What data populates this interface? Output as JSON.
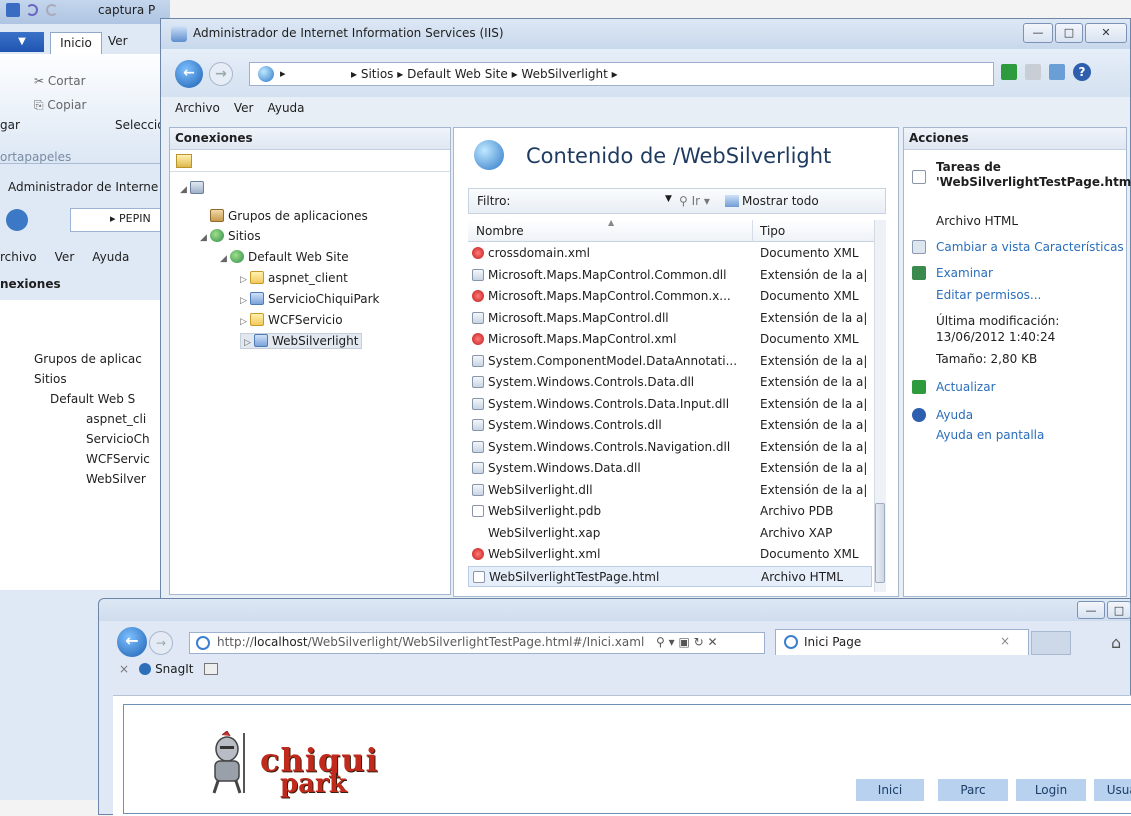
{
  "paint": {
    "title": "captura",
    "title_tail": "P",
    "tabs": [
      "Inicio",
      "Ver"
    ],
    "cortar": "Cortar",
    "copiar": "Copiar",
    "pegar": "gar",
    "seleccion": "Seleccio",
    "portapapeles": "ortapapeles",
    "image_title": "Administrador de Interne",
    "addr": "PEPIN",
    "menu": [
      "rchivo",
      "Ver",
      "Ayuda"
    ],
    "conexiones": "nexiones",
    "tree": [
      "Grupos de aplicac",
      "Sitios",
      "Default Web S",
      "aspnet_cli",
      "ServicioCh",
      "WCFServic",
      "WebSilver"
    ]
  },
  "iis": {
    "title": "Administrador de Internet Information Services (IIS)",
    "breadcrumb": "▸ Sitios ▸ Default Web Site ▸ WebSilverlight ▸",
    "menu": {
      "archivo": "Archivo",
      "ver": "Ver",
      "ayuda": "Ayuda"
    },
    "connections": {
      "header": "Conexiones",
      "tree": {
        "pools": "Grupos de aplicaciones",
        "sites": "Sitios",
        "default_site": "Default Web Site",
        "aspnet": "aspnet_client",
        "chiqui": "ServicioChiquiPark",
        "wcf": "WCFServicio",
        "ws": "WebSilverlight"
      }
    },
    "content": {
      "title": "Contenido de /WebSilverlight",
      "filter_label": "Filtro:",
      "go": "Ir",
      "show_all": "Mostrar todo",
      "col_name": "Nombre",
      "col_type": "Tipo",
      "files": [
        {
          "name": "crossdomain.xml",
          "type": "Documento XML",
          "icon": "xml"
        },
        {
          "name": "Microsoft.Maps.MapControl.Common.dll",
          "type": "Extensión de la a|",
          "icon": "dll"
        },
        {
          "name": "Microsoft.Maps.MapControl.Common.x...",
          "type": "Documento XML",
          "icon": "xml"
        },
        {
          "name": "Microsoft.Maps.MapControl.dll",
          "type": "Extensión de la a|",
          "icon": "dll"
        },
        {
          "name": "Microsoft.Maps.MapControl.xml",
          "type": "Documento XML",
          "icon": "xml"
        },
        {
          "name": "System.ComponentModel.DataAnnotati...",
          "type": "Extensión de la a|",
          "icon": "dll"
        },
        {
          "name": "System.Windows.Controls.Data.dll",
          "type": "Extensión de la a|",
          "icon": "dll"
        },
        {
          "name": "System.Windows.Controls.Data.Input.dll",
          "type": "Extensión de la a|",
          "icon": "dll"
        },
        {
          "name": "System.Windows.Controls.dll",
          "type": "Extensión de la a|",
          "icon": "dll"
        },
        {
          "name": "System.Windows.Controls.Navigation.dll",
          "type": "Extensión de la a|",
          "icon": "dll"
        },
        {
          "name": "System.Windows.Data.dll",
          "type": "Extensión de la a|",
          "icon": "dll"
        },
        {
          "name": "WebSilverlight.dll",
          "type": "Extensión de la a|",
          "icon": "dll"
        },
        {
          "name": "WebSilverlight.pdb",
          "type": "Archivo PDB",
          "icon": "doc"
        },
        {
          "name": "WebSilverlight.xap",
          "type": "Archivo XAP",
          "icon": "none"
        },
        {
          "name": "WebSilverlight.xml",
          "type": "Documento XML",
          "icon": "xml"
        },
        {
          "name": "WebSilverlightTestPage.html",
          "type": "Archivo HTML",
          "icon": "doc"
        }
      ],
      "selected_index": 15
    },
    "actions": {
      "header": "Acciones",
      "tasks_title": "Tareas de 'WebSilverlightTestPage.html'",
      "file_type": "Archivo HTML",
      "change_view": "Cambiar a vista Características",
      "explore": "Examinar",
      "edit_perms": "Editar permisos...",
      "last_mod_label": "Última modificación:",
      "last_mod_value": "13/06/2012 1:40:24",
      "size": "Tamaño: 2,80 KB",
      "refresh": "Actualizar",
      "help": "Ayuda",
      "online_help": "Ayuda en pantalla"
    }
  },
  "ie": {
    "url_prefix": "http://",
    "url_host": "localhost",
    "url_path": "/WebSilverlight/WebSilverlightTestPage.html#/Inici.xaml",
    "tab_title": "Inici Page",
    "tab_close": "×",
    "toolbar_close": "×",
    "snagit": "SnagIt",
    "site": {
      "logo_line1": "chiqui",
      "logo_line2": "park",
      "nav": [
        "Inici",
        "Parc",
        "Login",
        "Usuaris"
      ]
    }
  }
}
